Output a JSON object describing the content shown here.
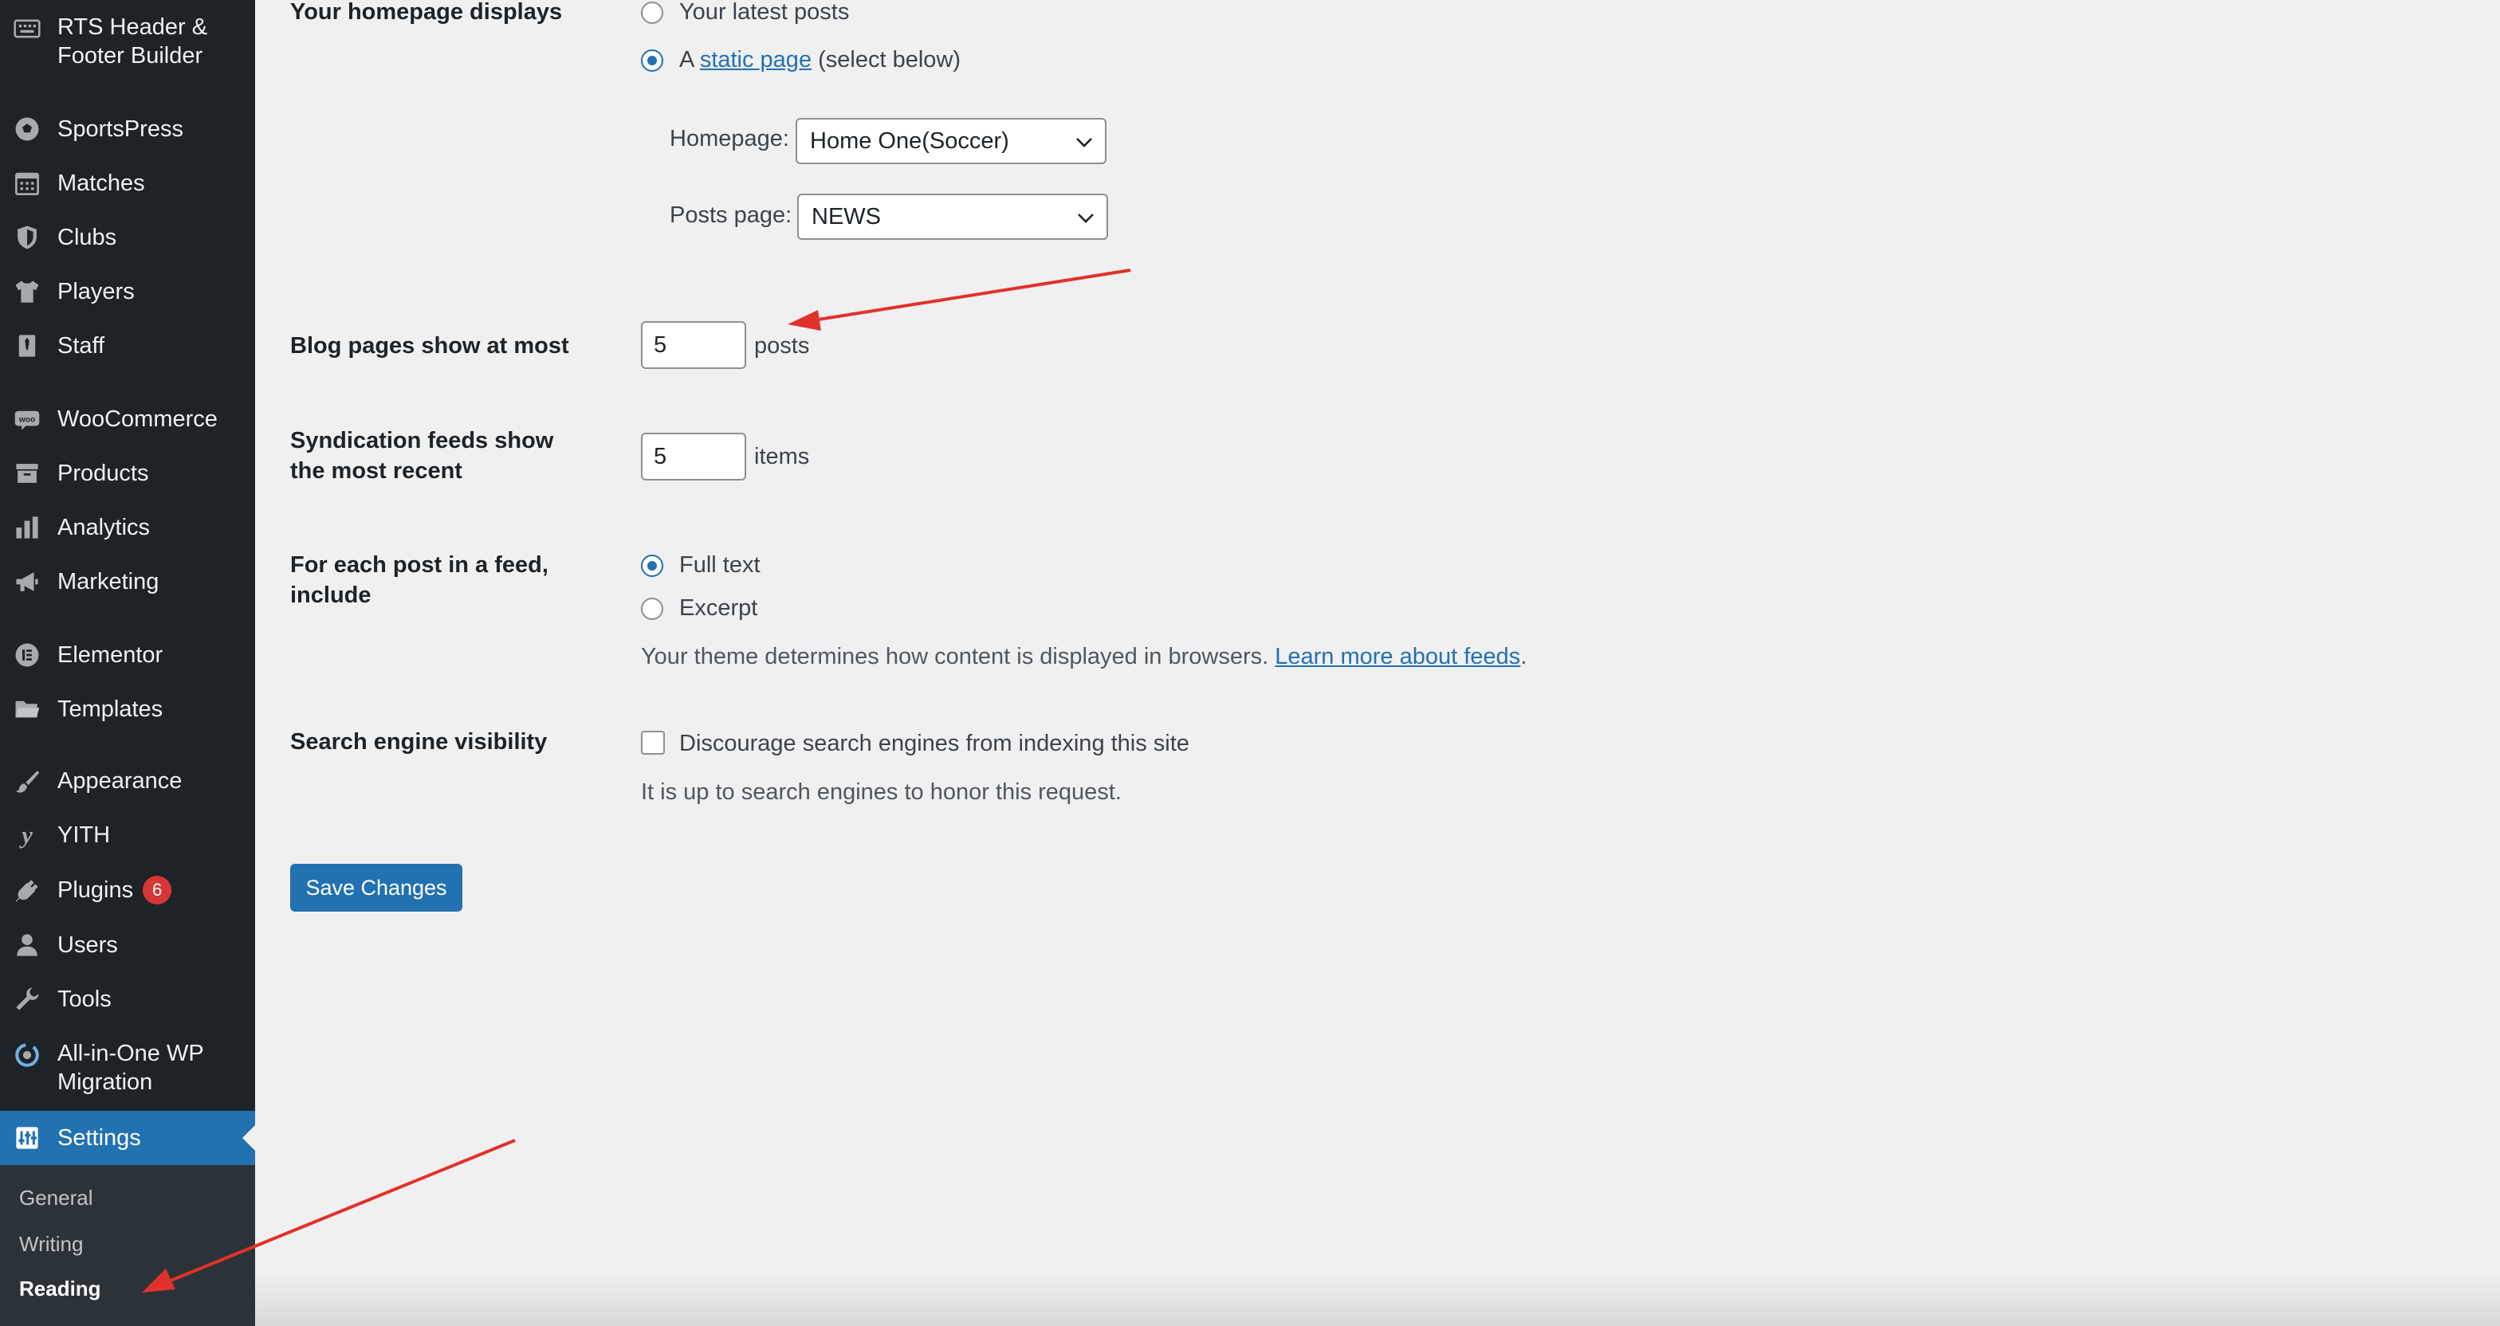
{
  "sidebar": {
    "items": [
      {
        "label": "RTS Header & Footer Builder",
        "icon": "keyboard-icon"
      },
      {
        "label": "SportsPress",
        "icon": "soccer-ball-icon"
      },
      {
        "label": "Matches",
        "icon": "calendar-icon"
      },
      {
        "label": "Clubs",
        "icon": "shield-icon"
      },
      {
        "label": "Players",
        "icon": "shirt-icon"
      },
      {
        "label": "Staff",
        "icon": "tie-icon"
      },
      {
        "label": "WooCommerce",
        "icon": "woo-icon"
      },
      {
        "label": "Products",
        "icon": "archive-icon"
      },
      {
        "label": "Analytics",
        "icon": "bar-chart-icon"
      },
      {
        "label": "Marketing",
        "icon": "megaphone-icon"
      },
      {
        "label": "Elementor",
        "icon": "elementor-icon"
      },
      {
        "label": "Templates",
        "icon": "folder-icon"
      },
      {
        "label": "Appearance",
        "icon": "paintbrush-icon"
      },
      {
        "label": "YITH",
        "icon": "yith-icon"
      },
      {
        "label": "Plugins",
        "icon": "plug-icon",
        "badge": "6"
      },
      {
        "label": "Users",
        "icon": "user-icon"
      },
      {
        "label": "Tools",
        "icon": "wrench-icon"
      },
      {
        "label": "All-in-One WP Migration",
        "icon": "migration-icon"
      },
      {
        "label": "Settings",
        "icon": "settings-icon"
      }
    ],
    "submenu": [
      "General",
      "Writing",
      "Reading"
    ]
  },
  "reading": {
    "homepage_displays": {
      "label": "Your homepage displays",
      "option_latest": "Your latest posts",
      "option_static_prefix": "A",
      "option_static_link": "static page",
      "option_static_suffix": "(select below)",
      "homepage_label": "Homepage:",
      "homepage_value": "Home One(Soccer)",
      "posts_page_label": "Posts page:",
      "posts_page_value": "NEWS"
    },
    "blog_pages": {
      "label": "Blog pages show at most",
      "value": "5",
      "unit": "posts"
    },
    "syndication": {
      "label": "Syndication feeds show the most recent",
      "value": "5",
      "unit": "items"
    },
    "feed_include": {
      "label": "For each post in a feed, include",
      "option_full": "Full text",
      "option_excerpt": "Excerpt",
      "note": "Your theme determines how content is displayed in browsers.",
      "note_link": "Learn more about feeds",
      "note_end": "."
    },
    "search_visibility": {
      "label": "Search engine visibility",
      "checkbox_label": "Discourage search engines from indexing this site",
      "note": "It is up to search engines to honor this request."
    },
    "save_label": "Save Changes"
  },
  "colors": {
    "sidebar_bg": "#1d2327",
    "accent": "#2271b1",
    "annotation_arrow": "#e0322a"
  }
}
